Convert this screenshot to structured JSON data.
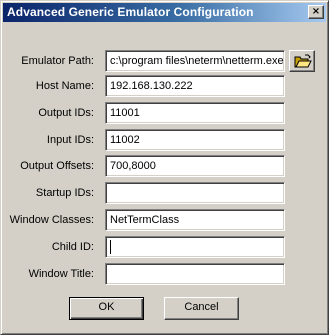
{
  "window": {
    "title": "Advanced Generic Emulator Configuration",
    "close_glyph": "×"
  },
  "fields": {
    "emulator_path": {
      "label": "Emulator Path:",
      "value": "c:\\program files\\neterm\\netterm.exe"
    },
    "host_name": {
      "label": "Host Name:",
      "value": "192.168.130.222"
    },
    "output_ids": {
      "label": "Output IDs:",
      "value": "11001"
    },
    "input_ids": {
      "label": "Input IDs:",
      "value": "11002"
    },
    "output_offsets": {
      "label": "Output Offsets:",
      "value": "700,8000"
    },
    "startup_ids": {
      "label": "Startup IDs:",
      "value": ""
    },
    "window_classes": {
      "label": "Window Classes:",
      "value": "NetTermClass"
    },
    "child_id": {
      "label": "Child ID:",
      "value": ""
    },
    "window_title": {
      "label": "Window Title:",
      "value": ""
    }
  },
  "buttons": {
    "ok": "OK",
    "cancel": "Cancel",
    "browse_icon": "open-folder-icon"
  },
  "colors": {
    "titlebar_start": "#0a246a",
    "titlebar_end": "#a6caf0",
    "dialog_face": "#d4d0c8"
  }
}
